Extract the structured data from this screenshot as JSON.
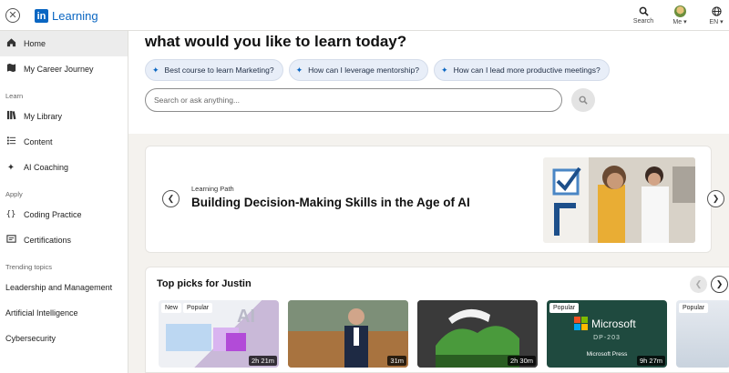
{
  "brand": {
    "name": "Learning",
    "logo_text": "in"
  },
  "topbar": {
    "actions": [
      {
        "label": "Search",
        "icon": "search-icon"
      },
      {
        "label": "Me ▾",
        "icon": "avatar"
      },
      {
        "label": "EN ▾",
        "icon": "globe-icon"
      }
    ]
  },
  "sidebar": {
    "items_top": [
      {
        "label": "Home",
        "icon": "home-icon",
        "active": true
      },
      {
        "label": "My Career Journey",
        "icon": "map-icon"
      }
    ],
    "learn_heading": "Learn",
    "learn_items": [
      {
        "label": "My Library",
        "icon": "library-icon"
      },
      {
        "label": "Content",
        "icon": "list-icon"
      },
      {
        "label": "AI Coaching",
        "icon": "sparkle-icon"
      }
    ],
    "apply_heading": "Apply",
    "apply_items": [
      {
        "label": "Coding Practice",
        "icon": "code-icon"
      },
      {
        "label": "Certifications",
        "icon": "certificate-icon"
      }
    ],
    "trending_heading": "Trending topics",
    "trending_items": [
      "Leadership and Management",
      "Artificial Intelligence",
      "Cybersecurity"
    ]
  },
  "hero": {
    "title": "what would you like to learn today?",
    "chips": [
      "Best course to learn Marketing?",
      "How can I leverage mentorship?",
      "How can I lead more productive meetings?"
    ],
    "search_placeholder": "Search or ask anything..."
  },
  "learning_path": {
    "kicker": "Learning Path",
    "title": "Building Decision-Making Skills in the Age of AI"
  },
  "top_picks": {
    "title": "Top picks for Justin",
    "cards": [
      {
        "badges": [
          "New",
          "Popular"
        ],
        "duration": "2h 21m"
      },
      {
        "badges": [],
        "duration": "31m"
      },
      {
        "badges": [],
        "duration": "2h 30m"
      },
      {
        "badges": [
          "Popular"
        ],
        "duration": "9h 27m",
        "brand": "Microsoft",
        "code": "DP-203",
        "publisher": "Microsoft Press"
      },
      {
        "badges": [
          "Popular"
        ],
        "duration": ""
      }
    ]
  },
  "colors": {
    "accent": "#0a66c2",
    "bg": "#f4f2ee"
  }
}
